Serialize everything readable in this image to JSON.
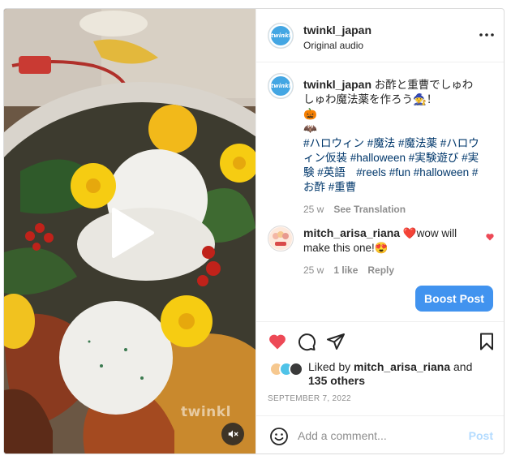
{
  "header": {
    "username": "twinkl_japan",
    "audio": "Original audio",
    "more_icon": "more-horizontal-icon"
  },
  "caption": {
    "username": "twinkl_japan",
    "text_line": "お酢と重曹でしゅわしゅわ魔法薬を作ろう🧙！",
    "emoji_1": "🎃",
    "emoji_2": "🦇",
    "hashtags": "#ハロウィン #魔法 #魔法薬 #ハロウィン仮装 #halloween #実験遊び #実験 #英語　#reels #fun #halloween #お酢 #重曹",
    "age": "25 w",
    "see_translation": "See Translation"
  },
  "comment": {
    "username": "mitch_arisa_riana",
    "text": "❤️wow will make this one!😍",
    "age": "25 w",
    "likes": "1 like",
    "reply": "Reply"
  },
  "boost_label": "Boost Post",
  "likes": {
    "prefix": "Liked by",
    "user": "mitch_arisa_riana",
    "and": "and",
    "others": "135 others"
  },
  "date": "SEPTEMBER 7, 2022",
  "add_comment": {
    "placeholder": "Add a comment...",
    "post_label": "Post"
  },
  "media": {
    "watermark": "twinkl"
  },
  "colors": {
    "brand_blue": "#4193ef",
    "like_red": "#ed4956",
    "hashtag": "#00376b",
    "muted": "#8e8e8e"
  }
}
